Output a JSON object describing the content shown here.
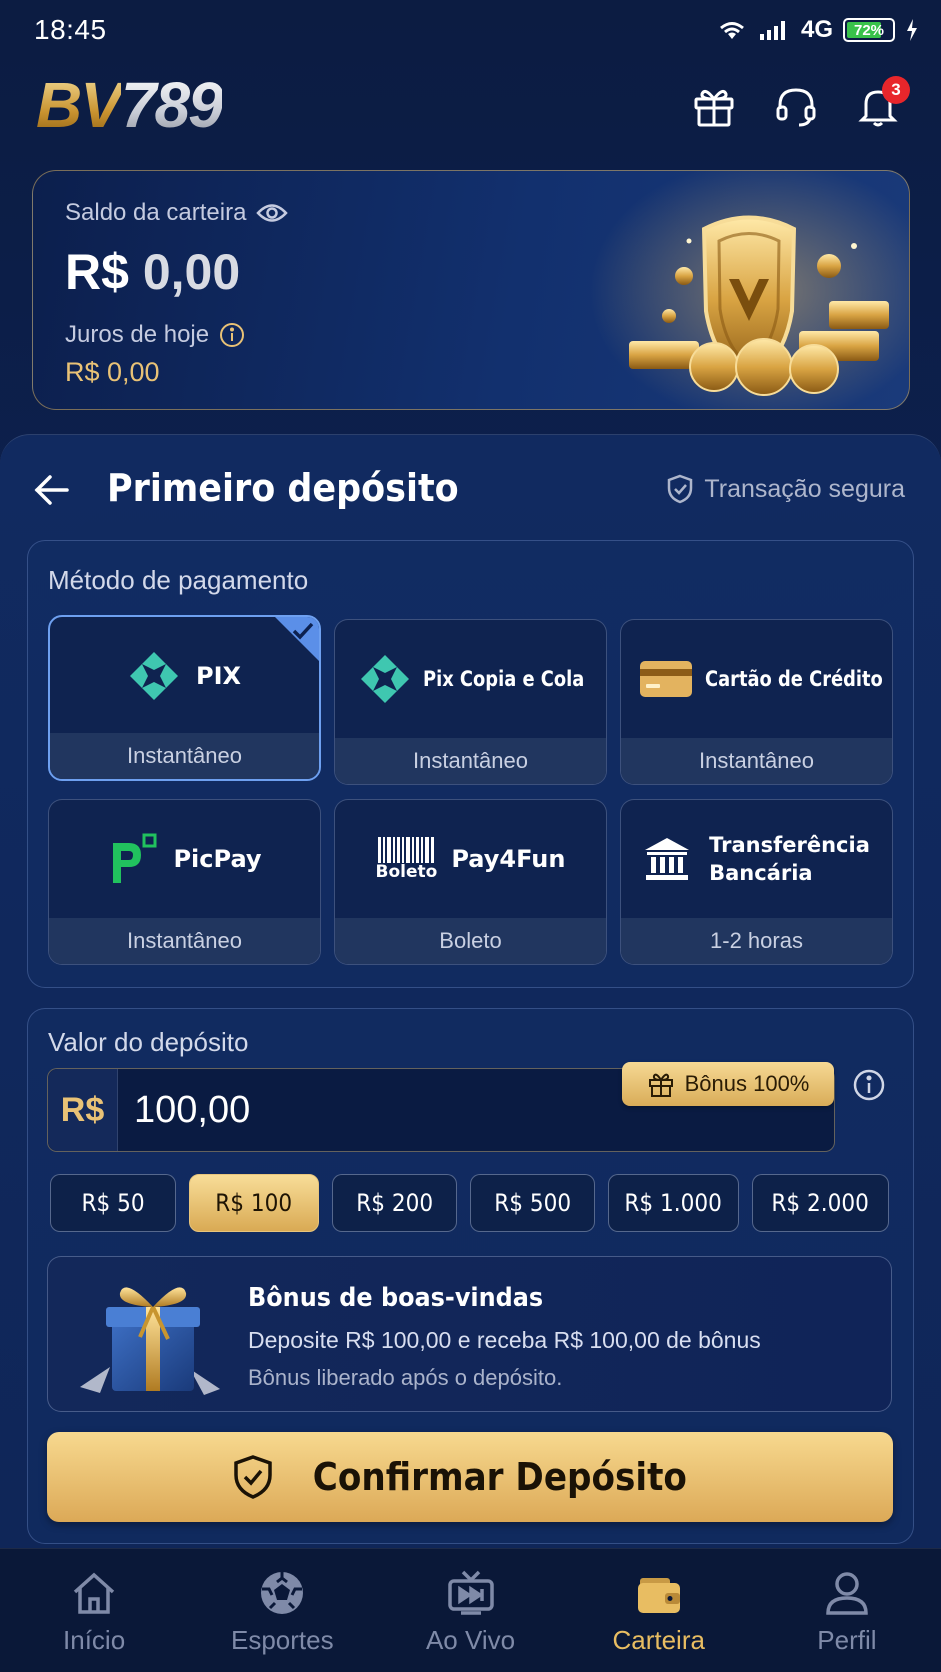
{
  "status_bar": {
    "time": "18:45",
    "network": "4G",
    "battery": "72%"
  },
  "header": {
    "logo_bv": "BV",
    "logo_num": "789",
    "notification_count": "3",
    "icons": [
      "gift-icon",
      "headset-icon",
      "bell-icon"
    ]
  },
  "wallet": {
    "label": "Saldo da carteira",
    "balance_currency": "R$",
    "balance_value": "0,00",
    "interest_label": "Juros de hoje",
    "interest_value": "R$ 0,00"
  },
  "page": {
    "title": "Primeiro depósito",
    "secure_label": "Transação segura"
  },
  "payment": {
    "section_label": "Método de pagamento",
    "methods": [
      {
        "name": "PIX",
        "subtitle": "Instantâneo",
        "icon": "pix-icon",
        "selected": true
      },
      {
        "name": "Pix Copia e Cola",
        "subtitle": "Instantâneo",
        "icon": "pix-icon",
        "selected": false
      },
      {
        "name": "Cartão de Crédito",
        "subtitle": "Instantâneo",
        "icon": "credit-card-icon",
        "selected": false
      },
      {
        "name": "PicPay",
        "subtitle": "Instantâneo",
        "icon": "picpay-icon",
        "selected": false
      },
      {
        "name": "Pay4Fun",
        "icon_text": "Boleto",
        "subtitle": "Boleto",
        "icon": "barcode-icon",
        "selected": false
      },
      {
        "name_line1": "Transferência",
        "name_line2": "Bancária",
        "subtitle": "1-2 horas",
        "icon": "bank-icon",
        "selected": false
      }
    ]
  },
  "deposit": {
    "section_label": "Valor do depósito",
    "currency": "R$",
    "amount": "100,00",
    "bonus_tag": "Bônus 100%",
    "presets": [
      "R$ 50",
      "R$ 100",
      "R$ 200",
      "R$ 500",
      "R$ 1.000",
      "R$ 2.000"
    ],
    "selected_preset": "R$ 100"
  },
  "welcome": {
    "title": "Bônus de boas-vindas",
    "description": "Deposite R$ 100,00 e receba R$ 100,00 de bônus",
    "note": "Bônus liberado após o depósito."
  },
  "confirm_label": "Confirmar Depósito",
  "nav": {
    "items": [
      {
        "label": "Início",
        "icon": "home-icon"
      },
      {
        "label": "Esportes",
        "icon": "soccer-ball-icon"
      },
      {
        "label": "Ao Vivo",
        "icon": "live-tv-icon"
      },
      {
        "label": "Carteira",
        "icon": "wallet-icon",
        "active": true
      },
      {
        "label": "Perfil",
        "icon": "user-icon"
      }
    ]
  },
  "colors": {
    "accent_gold": "#e8bd62",
    "selected_blue": "#6ea0f0",
    "badge_red": "#e8262b",
    "pix_teal": "#3fc7b0",
    "picpay_green": "#21c25e"
  }
}
